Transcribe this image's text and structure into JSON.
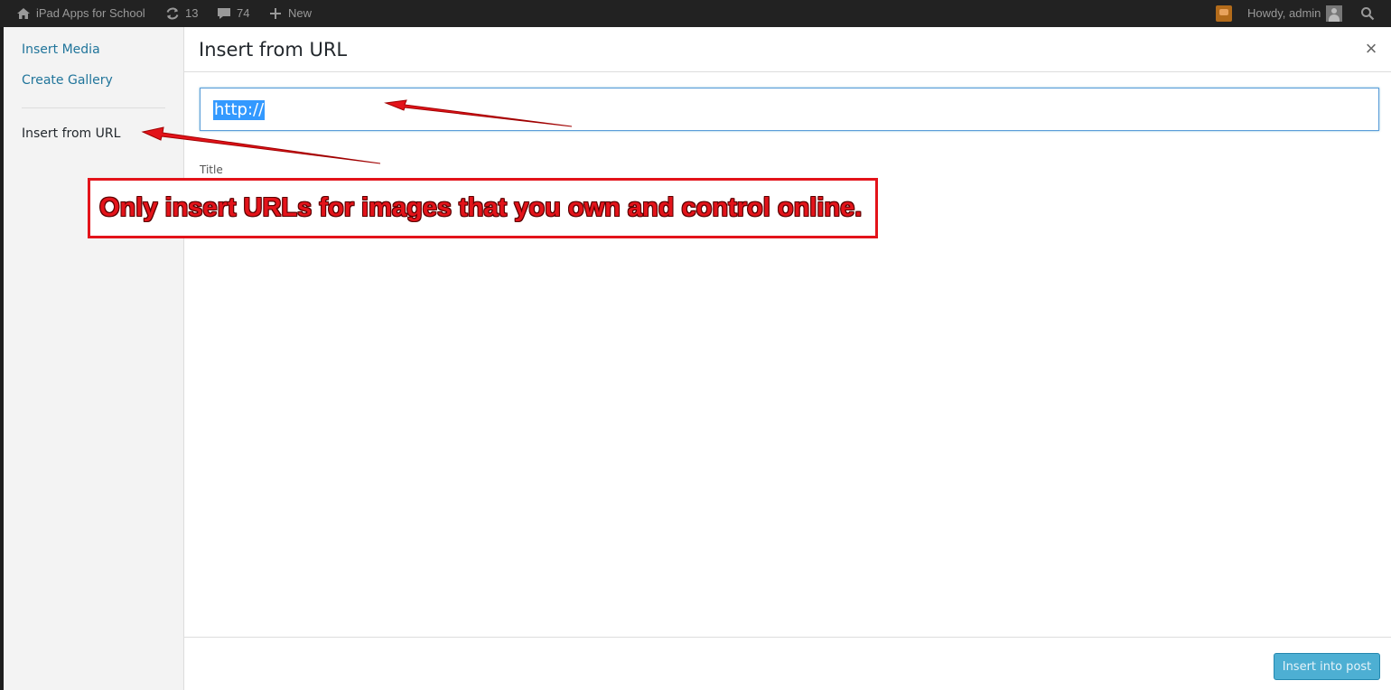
{
  "admin_bar": {
    "site_name": "iPad Apps for School",
    "updates_count": "13",
    "comments_count": "74",
    "new_label": "New",
    "greeting": "Howdy, admin"
  },
  "media_menu": {
    "items": [
      {
        "label": "Insert Media"
      },
      {
        "label": "Create Gallery"
      },
      {
        "label": "Insert from URL"
      }
    ]
  },
  "frame": {
    "title": "Insert from URL",
    "close_glyph": "×"
  },
  "embed": {
    "url_value": "http://",
    "title_label": "Title",
    "title_value": ""
  },
  "toolbar": {
    "insert_button_label": "Insert into post"
  },
  "annotation": {
    "callout_text": "Only insert URLs for images that you own and control online.",
    "color": "#e3131a"
  },
  "colors": {
    "admin_bar_bg": "#222222",
    "link": "#21759b",
    "primary_button": "#2ea2cc",
    "focus_border": "#5b9dd9",
    "selection": "#3399ff"
  }
}
